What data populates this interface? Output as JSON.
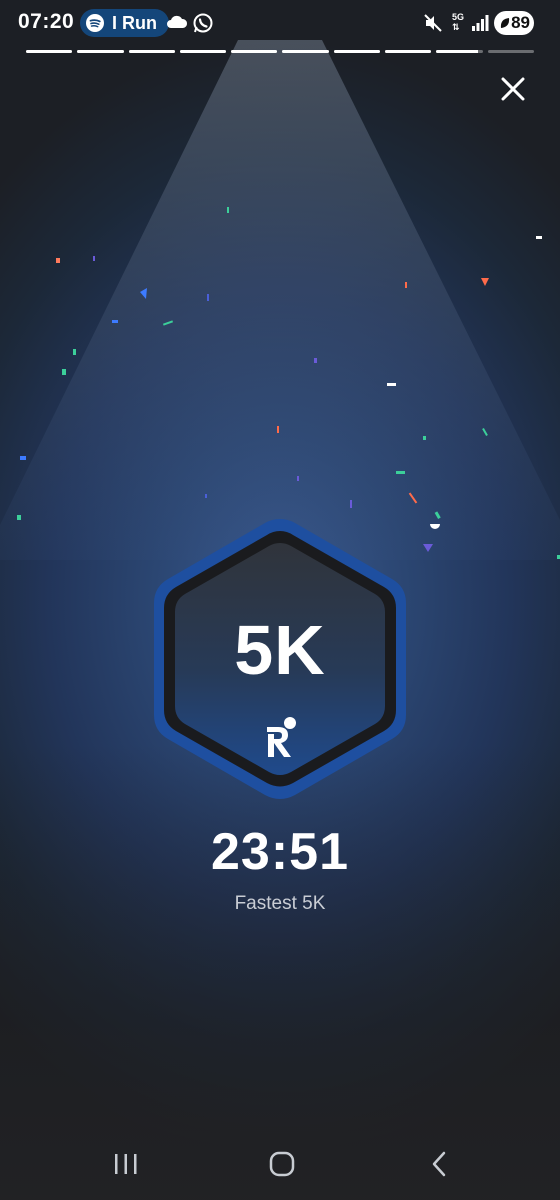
{
  "status_bar": {
    "time": "07:20",
    "media_app": "I Run",
    "network": "5G",
    "battery": "89"
  },
  "story": {
    "segments_total": 10,
    "segments_completed": 9,
    "current_segment_progress": 0.9
  },
  "achievement": {
    "badge_title": "5K",
    "time": "23:51",
    "label": "Fastest 5K"
  },
  "icons": {
    "close": "close-icon",
    "spotify": "spotify-icon",
    "cloud": "cloud-icon",
    "whatsapp": "whatsapp-icon",
    "mute": "mute-icon",
    "signal": "signal-icon",
    "battery": "battery-icon",
    "badge_logo": "runner-logo-icon",
    "nav_recents": "recents-icon",
    "nav_home": "home-icon",
    "nav_back": "back-icon"
  },
  "colors": {
    "badge_outer": "#1e4fa0",
    "badge_ring": "#1a1b1e",
    "badge_inner_top": "#2f333b",
    "badge_inner_bottom": "#1f4a88",
    "accent_pill": "#14467a"
  }
}
